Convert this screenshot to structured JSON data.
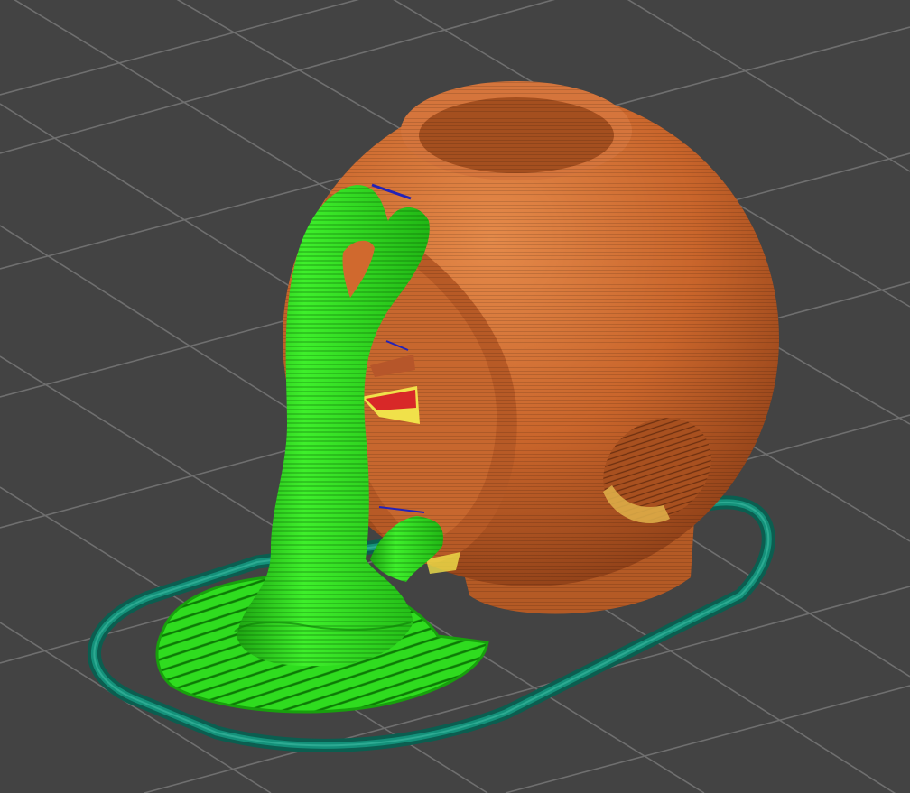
{
  "viewport": {
    "background": "#434343",
    "grid_color": "#6f6f6f"
  },
  "scene": {
    "model_color": "#c9652b",
    "support_color": "#27d11a",
    "skirt_color": "#0e7664",
    "highlight_colors": [
      "#d82828",
      "#f0e14a",
      "#2323b8"
    ]
  }
}
